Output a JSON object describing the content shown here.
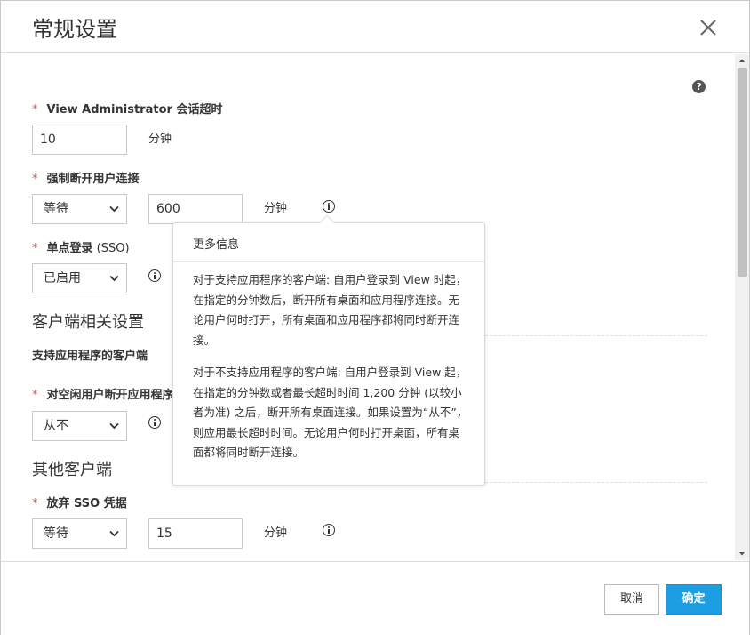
{
  "dialog": {
    "title": "常规设置"
  },
  "fields": {
    "session_timeout": {
      "label": "View Administrator 会话超时",
      "value": "10",
      "unit": "分钟"
    },
    "force_disconnect": {
      "label": "强制断开用户连接",
      "select": "等待",
      "value": "600",
      "unit": "分钟"
    },
    "sso": {
      "label_main": "单点登录",
      "label_suffix": " (SSO)",
      "select": "已启用"
    },
    "idle_disconnect": {
      "label": "对空闲用户断开应用程序",
      "select": "从不"
    },
    "discard_sso": {
      "label": "放弃 SSO 凭据",
      "select": "等待",
      "value": "15",
      "unit": "分钟"
    }
  },
  "sections": {
    "client": "客户端相关设置",
    "client_sub": "支持应用程序的客户端",
    "other": "其他客户端"
  },
  "popover": {
    "title": "更多信息",
    "p1": "对于支持应用程序的客户端: 自用户登录到 View 时起，在指定的分钟数后，断开所有桌面和应用程序连接。无论用户何时打开，所有桌面和应用程序都将同时断开连接。",
    "p2": "对于不支持应用程序的客户端: 自用户登录到 View 起，在指定的分钟数或者最长超时时间 1,200 分钟 (以较小者为准) 之后，断开所有桌面连接。如果设置为“从不”，则应用最长超时时间。无论用户何时打开桌面，所有桌面都将同时断开连接。"
  },
  "help": "?",
  "required_mark": "*",
  "footer": {
    "cancel": "取消",
    "ok": "确定"
  },
  "colors": {
    "primary": "#1d9de2",
    "required": "#d9534f"
  }
}
